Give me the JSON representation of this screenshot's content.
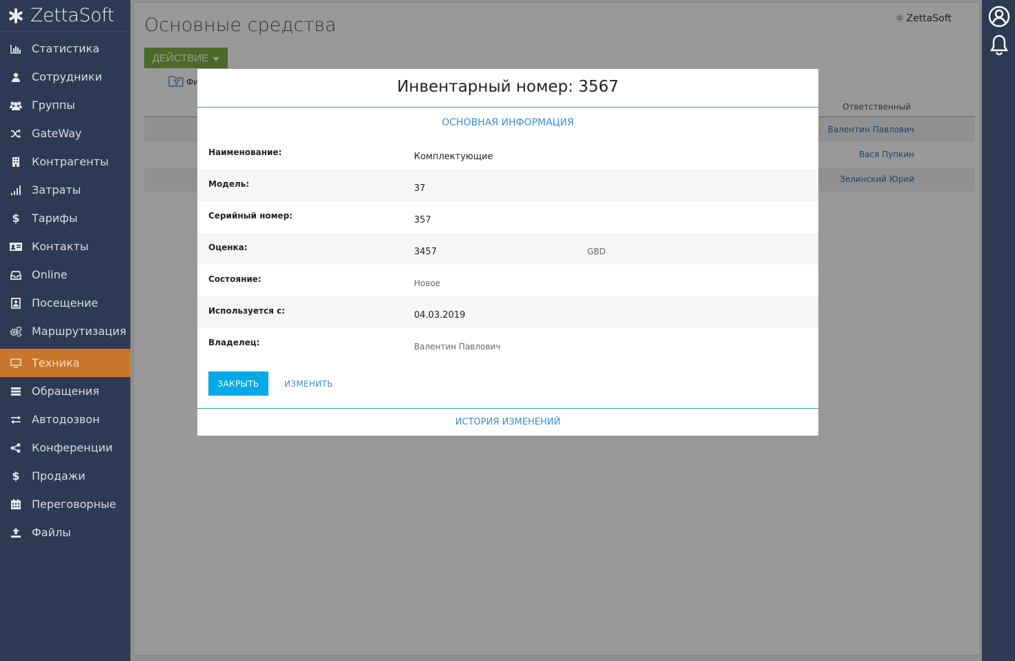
{
  "app": {
    "name": "ZettaSoft"
  },
  "sidebar": {
    "items": [
      {
        "label": "Статистика",
        "icon": "bar-chart-icon"
      },
      {
        "label": "Сотрудники",
        "icon": "user-icon"
      },
      {
        "label": "Группы",
        "icon": "group-icon"
      },
      {
        "label": "GateWay",
        "icon": "shuffle-icon"
      },
      {
        "label": "Контрагенты",
        "icon": "building-icon"
      },
      {
        "label": "Затраты",
        "icon": "signal-icon"
      },
      {
        "label": "Тарифы",
        "icon": "dollar-icon"
      },
      {
        "label": "Контакты",
        "icon": "contact-card-icon"
      },
      {
        "label": "Online",
        "icon": "inbox-icon"
      },
      {
        "label": "Посещение",
        "icon": "badge-icon"
      },
      {
        "label": "Маршрутизация",
        "icon": "gears-icon"
      },
      {
        "label": "Техника",
        "icon": "monitor-icon",
        "active": true
      },
      {
        "label": "Обращения",
        "icon": "list-icon"
      },
      {
        "label": "Автодозвон",
        "icon": "exchange-icon"
      },
      {
        "label": "Конференции",
        "icon": "share-icon"
      },
      {
        "label": "Продажи",
        "icon": "dollar-icon"
      },
      {
        "label": "Переговорные",
        "icon": "calendar-icon"
      },
      {
        "label": "Файлы",
        "icon": "upload-icon"
      }
    ]
  },
  "main": {
    "title": "Основные средства",
    "action_button": "ДЕЙСТВИЕ",
    "filter_label": "Фи",
    "brand": "ZettaSoft",
    "table": {
      "column_responsible": "Ответственный",
      "rows": [
        {
          "responsible": "Валентин Павлович"
        },
        {
          "responsible": "Вася Пупкин"
        },
        {
          "responsible": "Зелинский Юрий"
        }
      ]
    }
  },
  "modal": {
    "title": "Инвентарный номер: 3567",
    "section_title": "ОСНОВНАЯ ИНФОРМАЦИЯ",
    "fields": [
      {
        "label": "Наименование:",
        "value": "Комплектующие"
      },
      {
        "label": "Модель:",
        "value": "37"
      },
      {
        "label": "Серийный номер:",
        "value": "357"
      },
      {
        "label": "Оценка:",
        "value": "3457",
        "extra": "GBD"
      },
      {
        "label": "Состояние:",
        "value": "Новое"
      },
      {
        "label": "Используется с:",
        "value": "04.03.2019"
      },
      {
        "label": "Владелец:",
        "value": "Валентин Павлович"
      }
    ],
    "close_button": "ЗАКРЫТЬ",
    "edit_button": "ИЗМЕНИТЬ",
    "footer_link": "ИСТОРИЯ ИЗМЕНЕНИЙ"
  },
  "colors": {
    "sidebar_bg": "#2c3a54",
    "active_item": "#c8762c",
    "action_green": "#7cb342",
    "primary_blue": "#04a9e8",
    "link_blue": "#3b8ed4",
    "divider_teal": "#33a2b5"
  }
}
